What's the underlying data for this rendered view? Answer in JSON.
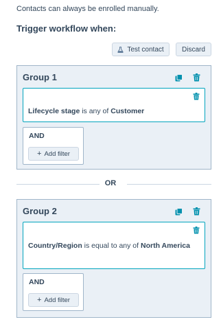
{
  "hint": "Contacts can always be enrolled manually.",
  "trigger_heading": "Trigger workflow when:",
  "toolbar": {
    "test_contact_label": "Test contact",
    "discard_label": "Discard"
  },
  "groups": [
    {
      "title": "Group 1",
      "filter": {
        "property": "Lifecycle stage",
        "operator": " is any of ",
        "value": "Customer"
      },
      "and_label": "AND",
      "add_filter_label": "Add filter"
    },
    {
      "title": "Group 2",
      "filter": {
        "property": "Country/Region",
        "operator": " is equal to any of ",
        "value": "North America"
      },
      "and_label": "AND",
      "add_filter_label": "Add filter"
    }
  ],
  "or_label": "OR",
  "colors": {
    "accent": "#00a4bd",
    "group_bg": "#eaf0f6",
    "border": "#9fb5c9",
    "text": "#33475b",
    "icon_teal": "#0091ae"
  },
  "icons": [
    "flask-icon",
    "copy-icon",
    "trash-icon",
    "plus-icon"
  ]
}
